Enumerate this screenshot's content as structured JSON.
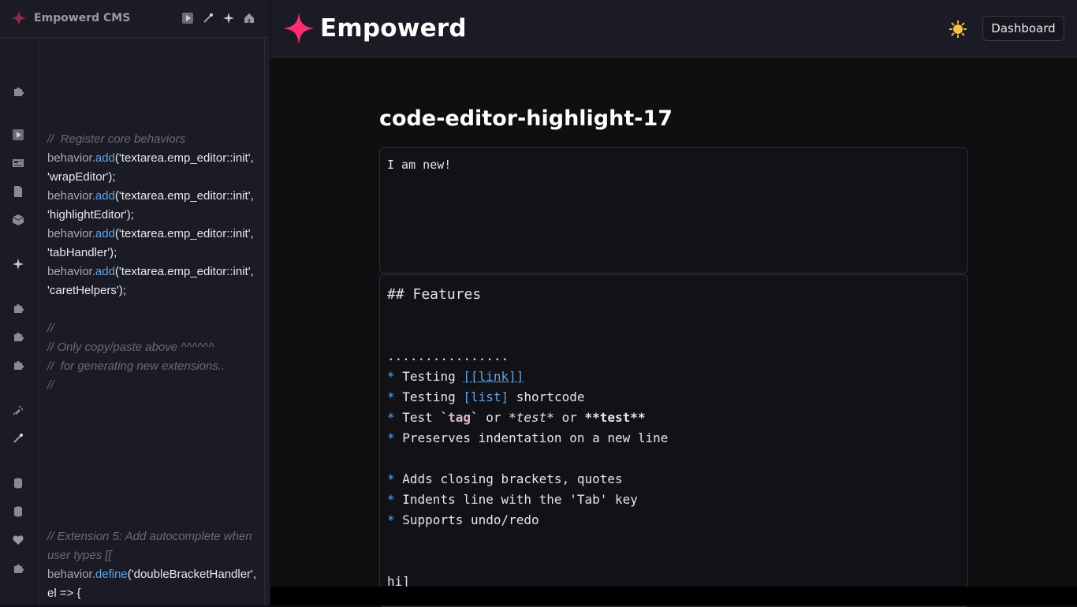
{
  "sidebar": {
    "app_name": "Empowerd CMS",
    "header_icons": [
      "play-icon",
      "wand-icon",
      "sparkles-icon",
      "home-icon"
    ],
    "rail_icons": [
      "puzzle-icon",
      "play-icon",
      "news-icon",
      "page-icon",
      "box-icon",
      "sparkles-icon",
      "puzzle-icon",
      "puzzle-icon",
      "puzzle-icon",
      "plug-icon",
      "wand-icon",
      "database-icon",
      "database-icon",
      "heart-icon",
      "puzzle-icon"
    ]
  },
  "code": {
    "c1": "//  Register core behaviors",
    "obj": "behavior.",
    "add": "add",
    "define": "define",
    "r1": "('textarea.emp_editor::init', 'wrapEditor');",
    "r2": "('textarea.emp_editor::init', 'highlightEditor');",
    "r3": "('textarea.emp_editor::init', 'tabHandler');",
    "r4": "('textarea.emp_editor::init', 'caretHelpers');",
    "c2": "//",
    "c3": "// Only copy/paste above ^^^^^^",
    "c4": "//  for generating new extensions..",
    "c5": "//",
    "c6": "// Extension 5: Add autocomplete when user types [[",
    "r5": "('doubleBracketHandler', el => {"
  },
  "topbar": {
    "title": "Empowerd",
    "dashboard_label": "Dashboard"
  },
  "main": {
    "page_title": "code-editor-highlight-17",
    "editor1_text": "I am new!",
    "md": {
      "heading": "## Features",
      "dots": "................",
      "star": "*",
      "l1a": " Testing ",
      "l1link": "[[link]]",
      "l2a": " Testing ",
      "l2sc": "[list]",
      "l2b": " shortcode",
      "l3a": " Test ",
      "l3tag": "`tag`",
      "l3b": " or ",
      "l3em": "*test*",
      "l3c": " or ",
      "l3strong": "**test**",
      "l4": " Preserves indentation on a new line",
      "l5": " Adds closing brackets, quotes",
      "l6": " Indents line with the 'Tab' key",
      "l7": " Supports undo/redo",
      "last": "hi]"
    }
  },
  "colors": {
    "accent": "#ff2d6f",
    "link": "#5fa3e8",
    "bg": "#0f0f12",
    "panel": "#1a1b24"
  }
}
